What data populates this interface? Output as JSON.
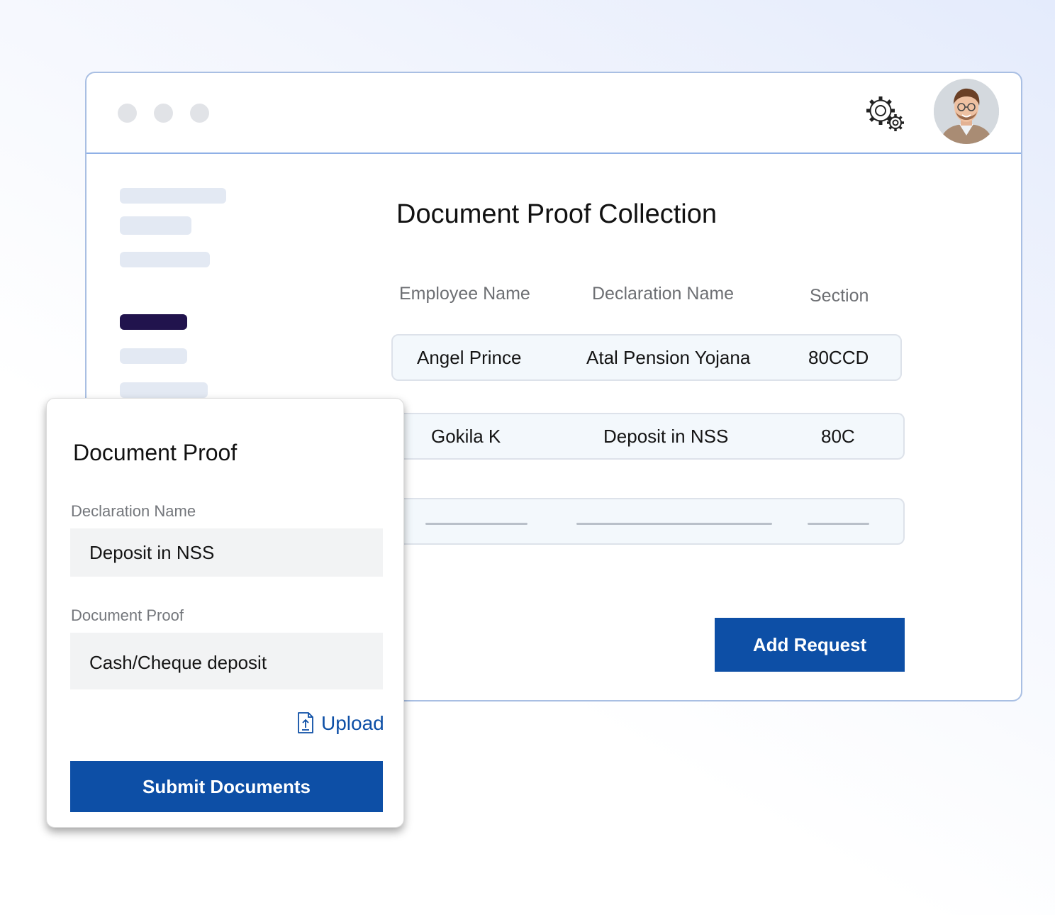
{
  "window": {
    "title_dots": 3,
    "settings_icon": "gear-cog-icon",
    "avatar_icon": "user-avatar"
  },
  "sidebar": {
    "placeholder_items": 6,
    "active_item_index": 3,
    "active_color": "#21134d"
  },
  "main": {
    "title": "Document Proof Collection",
    "columns": [
      "Employee Name",
      "Declaration Name",
      "Section"
    ],
    "rows": [
      {
        "employee": "Angel Prince",
        "declaration": "Atal Pension Yojana",
        "section": "80CCD"
      },
      {
        "employee": "Gokila K",
        "declaration": "Deposit in NSS",
        "section": "80C"
      }
    ],
    "placeholder_rows": 1,
    "add_button_label": "Add Request"
  },
  "modal": {
    "title": "Document Proof",
    "declaration_label": "Declaration Name",
    "declaration_value": "Deposit in NSS",
    "proof_label": "Document Proof",
    "proof_value": "Cash/Cheque deposit",
    "upload_label": "Upload",
    "upload_icon": "file-upload-icon",
    "submit_label": "Submit Documents"
  },
  "colors": {
    "accent": "#0d4fa6",
    "row_background": "#f3f8fc",
    "window_border": "#a9bfe3"
  }
}
